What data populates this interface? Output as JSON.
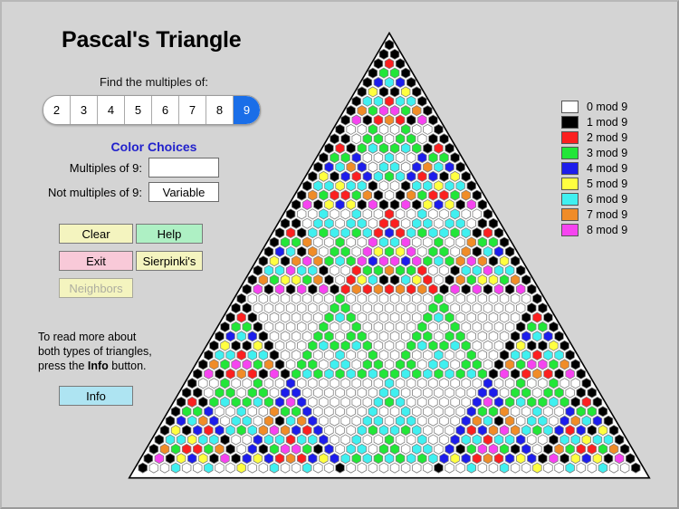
{
  "window": {
    "title": "Pascal's Triangle",
    "background": "#d4d4d4"
  },
  "controls": {
    "find_label": "Find the multiples of:",
    "tabs": [
      {
        "label": "2",
        "selected": false
      },
      {
        "label": "3",
        "selected": false
      },
      {
        "label": "4",
        "selected": false
      },
      {
        "label": "5",
        "selected": false
      },
      {
        "label": "6",
        "selected": false
      },
      {
        "label": "7",
        "selected": false
      },
      {
        "label": "8",
        "selected": false
      },
      {
        "label": "9",
        "selected": true
      }
    ],
    "selected_modulus": 9,
    "selected_tab_color": "#1a6ee8"
  },
  "color_choices": {
    "heading": "Color Choices",
    "multiples_label": "Multiples of 9:",
    "multiples_value": "",
    "multiples_swatch_color": "#ffffff",
    "not_multiples_label": "Not multiples of 9:",
    "not_multiples_value": "Variable"
  },
  "buttons": {
    "clear": "Clear",
    "help": "Help",
    "exit": "Exit",
    "sierpinski": "Sierpinki's",
    "neighbors": "Neighbors",
    "info": "Info"
  },
  "info_paragraph": {
    "line1": "To read more about",
    "line2": "both types of triangles,",
    "line3_pre": "press the ",
    "line3_bold": "Info",
    "line3_post": " button."
  },
  "legend": {
    "items": [
      {
        "label": "0 mod 9",
        "color": "#ffffff"
      },
      {
        "label": "1 mod 9",
        "color": "#000000"
      },
      {
        "label": "2 mod 9",
        "color": "#fb2020"
      },
      {
        "label": "3 mod 9",
        "color": "#22e638"
      },
      {
        "label": "4 mod 9",
        "color": "#1d1deb"
      },
      {
        "label": "5 mod 9",
        "color": "#ffff40"
      },
      {
        "label": "6 mod 9",
        "color": "#40f0f0"
      },
      {
        "label": "7 mod 9",
        "color": "#f08c28"
      },
      {
        "label": "8 mod 9",
        "color": "#f644f0"
      }
    ]
  },
  "chart_data": {
    "type": "heatmap",
    "title": "Pascal's Triangle mod 9",
    "rows": 46,
    "modulus": 9,
    "description": "Each cell at row n, position k is binomial(n,k) mod 9, drawn as a hexagon colored by residue.",
    "residue_colors": {
      "0": "#ffffff",
      "1": "#000000",
      "2": "#fb2020",
      "3": "#22e638",
      "4": "#1d1deb",
      "5": "#ffff40",
      "6": "#40f0f0",
      "7": "#f08c28",
      "8": "#f644f0"
    },
    "cell_shape": "hexagon",
    "cell_outline": "#808080",
    "triangle_fill": "#ffffff",
    "triangle_outline": "#000000",
    "legend_position": "right"
  }
}
